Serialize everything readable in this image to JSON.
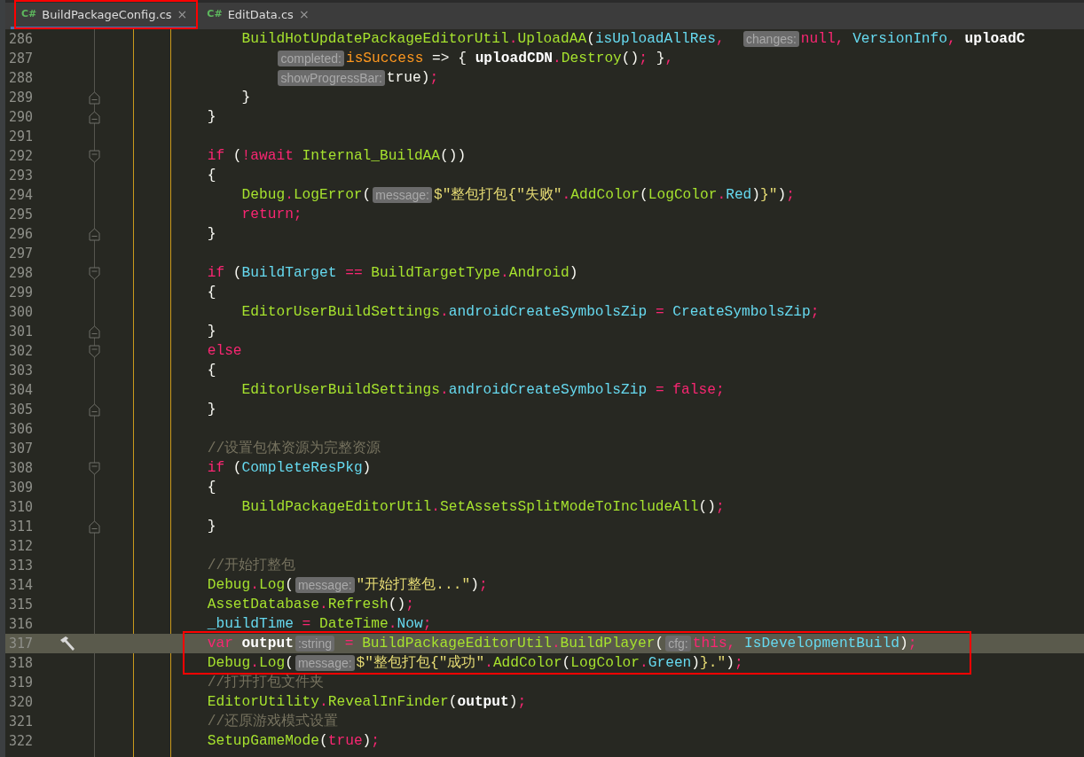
{
  "tabs": [
    {
      "icon_text": "C#",
      "label": "BuildPackageConfig.cs",
      "close": "×",
      "selected": true,
      "framed": true
    },
    {
      "icon_text": "C#",
      "label": "EditData.cs",
      "close": "×",
      "selected": false,
      "framed": false
    }
  ],
  "lines": [
    {
      "number": "286",
      "kind": "inner",
      "segments": [
        {
          "kind": "code",
          "tokens": [
            {
              "kind": "method",
              "text": "BuildHotUpdatePackageEditorUtil"
            },
            {
              "kind": "keyword",
              "text": "."
            },
            {
              "kind": "method",
              "text": "UploadAA"
            },
            {
              "kind": "plain",
              "text": "("
            },
            {
              "kind": "field",
              "text": "isUploadAllRes"
            },
            {
              "kind": "keyword",
              "text": ",  "
            }
          ]
        },
        {
          "kind": "hint",
          "text": "changes:"
        },
        {
          "kind": "code",
          "tokens": [
            {
              "kind": "keyword",
              "text": "null, "
            },
            {
              "kind": "field",
              "text": "VersionInfo"
            },
            {
              "kind": "keyword",
              "text": ", "
            },
            {
              "kind": "local",
              "text": "uploadC"
            }
          ]
        }
      ]
    },
    {
      "number": "287",
      "kind": "continuation",
      "segments": [
        {
          "kind": "hint",
          "text": "completed:"
        },
        {
          "kind": "code",
          "tokens": [
            {
              "kind": "param",
              "text": "isSuccess"
            },
            {
              "kind": "plain",
              "text": " => { "
            },
            {
              "kind": "local",
              "text": "uploadCDN"
            },
            {
              "kind": "keyword",
              "text": "."
            },
            {
              "kind": "method",
              "text": "Destroy"
            },
            {
              "kind": "plain",
              "text": "()"
            },
            {
              "kind": "keyword",
              "text": ";"
            },
            {
              "kind": "plain",
              "text": " }"
            },
            {
              "kind": "keyword",
              "text": ","
            }
          ]
        }
      ]
    },
    {
      "number": "288",
      "kind": "continuation",
      "segments": [
        {
          "kind": "hint",
          "text": "showProgressBar:"
        },
        {
          "kind": "code",
          "tokens": [
            {
              "kind": "plain",
              "text": "true"
            },
            {
              "kind": "plain",
              "text": ")"
            },
            {
              "kind": "keyword",
              "text": ";"
            }
          ]
        }
      ]
    },
    {
      "number": "289",
      "kind": "inner",
      "fold_end": true,
      "segments": [
        {
          "kind": "code",
          "tokens": [
            {
              "kind": "plain",
              "text": "}"
            }
          ]
        }
      ]
    },
    {
      "number": "290",
      "kind": "outer",
      "fold_end": true,
      "segments": [
        {
          "kind": "code",
          "tokens": [
            {
              "kind": "plain",
              "text": "}"
            }
          ]
        }
      ]
    },
    {
      "number": "291",
      "kind": "blank"
    },
    {
      "number": "292",
      "kind": "outer",
      "fold_start": true,
      "segments": [
        {
          "kind": "code",
          "tokens": [
            {
              "kind": "keyword",
              "text": "if"
            },
            {
              "kind": "plain",
              "text": " ("
            },
            {
              "kind": "keyword",
              "text": "!await "
            },
            {
              "kind": "method",
              "text": "Internal_BuildAA"
            },
            {
              "kind": "plain",
              "text": "())"
            }
          ]
        }
      ]
    },
    {
      "number": "293",
      "kind": "outer",
      "segments": [
        {
          "kind": "code",
          "tokens": [
            {
              "kind": "plain",
              "text": "{"
            }
          ]
        }
      ]
    },
    {
      "number": "294",
      "kind": "inner",
      "segments": [
        {
          "kind": "code",
          "tokens": [
            {
              "kind": "method",
              "text": "Debug"
            },
            {
              "kind": "keyword",
              "text": "."
            },
            {
              "kind": "method",
              "text": "LogError"
            },
            {
              "kind": "plain",
              "text": "("
            }
          ]
        },
        {
          "kind": "hint",
          "text": "message:"
        },
        {
          "kind": "code",
          "tokens": [
            {
              "kind": "string",
              "text": "$\"整包打包{\"失败\""
            },
            {
              "kind": "keyword",
              "text": "."
            },
            {
              "kind": "method",
              "text": "AddColor"
            },
            {
              "kind": "plain",
              "text": "("
            },
            {
              "kind": "method",
              "text": "LogColor"
            },
            {
              "kind": "keyword",
              "text": "."
            },
            {
              "kind": "field",
              "text": "Red"
            },
            {
              "kind": "plain",
              "text": ")"
            },
            {
              "kind": "string",
              "text": "}\""
            },
            {
              "kind": "plain",
              "text": ")"
            },
            {
              "kind": "keyword",
              "text": ";"
            }
          ]
        }
      ]
    },
    {
      "number": "295",
      "kind": "inner",
      "segments": [
        {
          "kind": "code",
          "tokens": [
            {
              "kind": "keyword",
              "text": "return;"
            }
          ]
        }
      ]
    },
    {
      "number": "296",
      "kind": "outer",
      "fold_end": true,
      "segments": [
        {
          "kind": "code",
          "tokens": [
            {
              "kind": "plain",
              "text": "}"
            }
          ]
        }
      ]
    },
    {
      "number": "297",
      "kind": "blank"
    },
    {
      "number": "298",
      "kind": "outer",
      "fold_start": true,
      "segments": [
        {
          "kind": "code",
          "tokens": [
            {
              "kind": "keyword",
              "text": "if"
            },
            {
              "kind": "plain",
              "text": " ("
            },
            {
              "kind": "field",
              "text": "BuildTarget"
            },
            {
              "kind": "keyword",
              "text": " == "
            },
            {
              "kind": "method",
              "text": "BuildTargetType"
            },
            {
              "kind": "keyword",
              "text": "."
            },
            {
              "kind": "method",
              "text": "Android"
            },
            {
              "kind": "plain",
              "text": ")"
            }
          ]
        }
      ]
    },
    {
      "number": "299",
      "kind": "outer",
      "segments": [
        {
          "kind": "code",
          "tokens": [
            {
              "kind": "plain",
              "text": "{"
            }
          ]
        }
      ]
    },
    {
      "number": "300",
      "kind": "inner",
      "segments": [
        {
          "kind": "code",
          "tokens": [
            {
              "kind": "method",
              "text": "EditorUserBuildSettings"
            },
            {
              "kind": "keyword",
              "text": "."
            },
            {
              "kind": "field",
              "text": "androidCreateSymbolsZip"
            },
            {
              "kind": "keyword",
              "text": " = "
            },
            {
              "kind": "field",
              "text": "CreateSymbolsZip"
            },
            {
              "kind": "keyword",
              "text": ";"
            }
          ]
        }
      ]
    },
    {
      "number": "301",
      "kind": "outer",
      "fold_end": true,
      "segments": [
        {
          "kind": "code",
          "tokens": [
            {
              "kind": "plain",
              "text": "}"
            }
          ]
        }
      ]
    },
    {
      "number": "302",
      "kind": "outer",
      "fold_start": true,
      "segments": [
        {
          "kind": "code",
          "tokens": [
            {
              "kind": "keyword",
              "text": "else"
            }
          ]
        }
      ]
    },
    {
      "number": "303",
      "kind": "outer",
      "segments": [
        {
          "kind": "code",
          "tokens": [
            {
              "kind": "plain",
              "text": "{"
            }
          ]
        }
      ]
    },
    {
      "number": "304",
      "kind": "inner",
      "segments": [
        {
          "kind": "code",
          "tokens": [
            {
              "kind": "method",
              "text": "EditorUserBuildSettings"
            },
            {
              "kind": "keyword",
              "text": "."
            },
            {
              "kind": "field",
              "text": "androidCreateSymbolsZip"
            },
            {
              "kind": "keyword",
              "text": " = false;"
            }
          ]
        }
      ]
    },
    {
      "number": "305",
      "kind": "outer",
      "fold_end": true,
      "segments": [
        {
          "kind": "code",
          "tokens": [
            {
              "kind": "plain",
              "text": "}"
            }
          ]
        }
      ]
    },
    {
      "number": "306",
      "kind": "blank"
    },
    {
      "number": "307",
      "kind": "outer",
      "segments": [
        {
          "kind": "code",
          "tokens": [
            {
              "kind": "comment",
              "text": "//设置包体资源为完整资源"
            }
          ]
        }
      ]
    },
    {
      "number": "308",
      "kind": "outer",
      "fold_start": true,
      "segments": [
        {
          "kind": "code",
          "tokens": [
            {
              "kind": "keyword",
              "text": "if"
            },
            {
              "kind": "plain",
              "text": " ("
            },
            {
              "kind": "field",
              "text": "CompleteResPkg"
            },
            {
              "kind": "plain",
              "text": ")"
            }
          ]
        }
      ]
    },
    {
      "number": "309",
      "kind": "outer",
      "segments": [
        {
          "kind": "code",
          "tokens": [
            {
              "kind": "plain",
              "text": "{"
            }
          ]
        }
      ]
    },
    {
      "number": "310",
      "kind": "inner",
      "segments": [
        {
          "kind": "code",
          "tokens": [
            {
              "kind": "method",
              "text": "BuildPackageEditorUtil"
            },
            {
              "kind": "keyword",
              "text": "."
            },
            {
              "kind": "method",
              "text": "SetAssetsSplitModeToIncludeAll"
            },
            {
              "kind": "plain",
              "text": "()"
            },
            {
              "kind": "keyword",
              "text": ";"
            }
          ]
        }
      ]
    },
    {
      "number": "311",
      "kind": "outer",
      "fold_end": true,
      "segments": [
        {
          "kind": "code",
          "tokens": [
            {
              "kind": "plain",
              "text": "}"
            }
          ]
        }
      ]
    },
    {
      "number": "312",
      "kind": "blank"
    },
    {
      "number": "313",
      "kind": "outer",
      "segments": [
        {
          "kind": "code",
          "tokens": [
            {
              "kind": "comment",
              "text": "//开始打整包"
            }
          ]
        }
      ]
    },
    {
      "number": "314",
      "kind": "outer",
      "segments": [
        {
          "kind": "code",
          "tokens": [
            {
              "kind": "method",
              "text": "Debug"
            },
            {
              "kind": "keyword",
              "text": "."
            },
            {
              "kind": "method",
              "text": "Log"
            },
            {
              "kind": "plain",
              "text": "("
            }
          ]
        },
        {
          "kind": "hint",
          "text": "message:"
        },
        {
          "kind": "code",
          "tokens": [
            {
              "kind": "string",
              "text": "\"开始打整包...\""
            },
            {
              "kind": "plain",
              "text": ")"
            },
            {
              "kind": "keyword",
              "text": ";"
            }
          ]
        }
      ]
    },
    {
      "number": "315",
      "kind": "outer",
      "segments": [
        {
          "kind": "code",
          "tokens": [
            {
              "kind": "method",
              "text": "AssetDatabase"
            },
            {
              "kind": "keyword",
              "text": "."
            },
            {
              "kind": "method",
              "text": "Refresh"
            },
            {
              "kind": "plain",
              "text": "()"
            },
            {
              "kind": "keyword",
              "text": ";"
            }
          ]
        }
      ]
    },
    {
      "number": "316",
      "kind": "outer",
      "segments": [
        {
          "kind": "code",
          "tokens": [
            {
              "kind": "field",
              "text": "_buildTime"
            },
            {
              "kind": "keyword",
              "text": " = "
            },
            {
              "kind": "method",
              "text": "DateTime"
            },
            {
              "kind": "keyword",
              "text": "."
            },
            {
              "kind": "field",
              "text": "Now"
            },
            {
              "kind": "keyword",
              "text": ";"
            }
          ]
        }
      ]
    },
    {
      "number": "317",
      "kind": "outer",
      "current": true,
      "framed": true,
      "segments": [
        {
          "kind": "code",
          "tokens": [
            {
              "kind": "keyword",
              "text": "var "
            },
            {
              "kind": "local",
              "text": "output"
            }
          ]
        },
        {
          "kind": "hint",
          "text": ":string"
        },
        {
          "kind": "code",
          "tokens": [
            {
              "kind": "keyword",
              "text": " = "
            },
            {
              "kind": "method",
              "text": "BuildPackageEditorUtil"
            },
            {
              "kind": "keyword",
              "text": "."
            },
            {
              "kind": "method",
              "text": "BuildPlayer"
            },
            {
              "kind": "plain",
              "text": "("
            }
          ]
        },
        {
          "kind": "hint",
          "text": "cfg:"
        },
        {
          "kind": "code",
          "tokens": [
            {
              "kind": "keyword",
              "text": "this, "
            },
            {
              "kind": "field",
              "text": "IsDevelopmentBuild"
            },
            {
              "kind": "plain",
              "text": ")"
            },
            {
              "kind": "keyword",
              "text": ";"
            }
          ]
        }
      ]
    },
    {
      "number": "318",
      "kind": "outer",
      "framed": true,
      "segments": [
        {
          "kind": "code",
          "tokens": [
            {
              "kind": "method",
              "text": "Debug"
            },
            {
              "kind": "keyword",
              "text": "."
            },
            {
              "kind": "method",
              "text": "Log"
            },
            {
              "kind": "plain",
              "text": "("
            }
          ]
        },
        {
          "kind": "hint",
          "text": "message:"
        },
        {
          "kind": "code",
          "tokens": [
            {
              "kind": "string",
              "text": "$\"整包打包{\"成功\""
            },
            {
              "kind": "keyword",
              "text": "."
            },
            {
              "kind": "method",
              "text": "AddColor"
            },
            {
              "kind": "plain",
              "text": "("
            },
            {
              "kind": "method",
              "text": "LogColor"
            },
            {
              "kind": "keyword",
              "text": "."
            },
            {
              "kind": "field",
              "text": "Green"
            },
            {
              "kind": "plain",
              "text": ")"
            },
            {
              "kind": "string",
              "text": "}.\""
            },
            {
              "kind": "plain",
              "text": ")"
            },
            {
              "kind": "keyword",
              "text": ";"
            }
          ]
        }
      ]
    },
    {
      "number": "319",
      "kind": "outer",
      "segments": [
        {
          "kind": "code",
          "tokens": [
            {
              "kind": "comment",
              "text": "//打开打包文件夹"
            }
          ]
        }
      ]
    },
    {
      "number": "320",
      "kind": "outer",
      "segments": [
        {
          "kind": "code",
          "tokens": [
            {
              "kind": "method",
              "text": "EditorUtility"
            },
            {
              "kind": "keyword",
              "text": "."
            },
            {
              "kind": "method",
              "text": "RevealInFinder"
            },
            {
              "kind": "plain",
              "text": "("
            },
            {
              "kind": "local",
              "text": "output"
            },
            {
              "kind": "plain",
              "text": ")"
            },
            {
              "kind": "keyword",
              "text": ";"
            }
          ]
        }
      ]
    },
    {
      "number": "321",
      "kind": "outer",
      "segments": [
        {
          "kind": "code",
          "tokens": [
            {
              "kind": "comment",
              "text": "//还原游戏模式设置"
            }
          ]
        }
      ]
    },
    {
      "number": "322",
      "kind": "outer",
      "segments": [
        {
          "kind": "code",
          "tokens": [
            {
              "kind": "method",
              "text": "SetupGameMode"
            },
            {
              "kind": "plain",
              "text": "("
            },
            {
              "kind": "keyword",
              "text": "true"
            },
            {
              "kind": "plain",
              "text": ")"
            },
            {
              "kind": "keyword",
              "text": ";"
            }
          ]
        }
      ]
    }
  ]
}
